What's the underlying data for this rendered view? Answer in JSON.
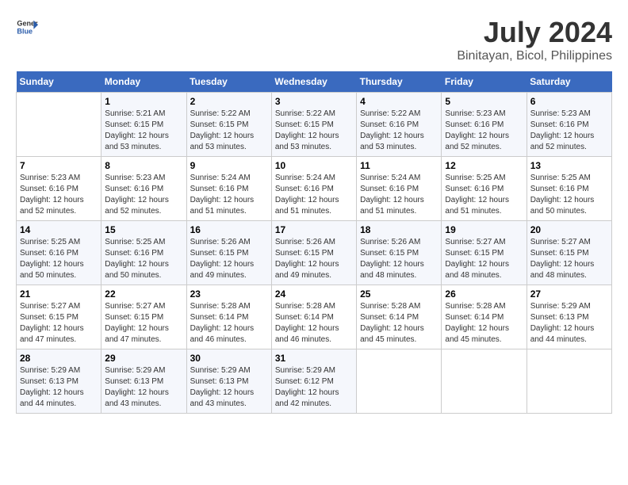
{
  "logo": {
    "line1": "General",
    "line2": "Blue"
  },
  "title": "July 2024",
  "subtitle": "Binitayan, Bicol, Philippines",
  "days_header": [
    "Sunday",
    "Monday",
    "Tuesday",
    "Wednesday",
    "Thursday",
    "Friday",
    "Saturday"
  ],
  "weeks": [
    [
      {
        "num": "",
        "sunrise": "",
        "sunset": "",
        "daylight": ""
      },
      {
        "num": "1",
        "sunrise": "Sunrise: 5:21 AM",
        "sunset": "Sunset: 6:15 PM",
        "daylight": "Daylight: 12 hours and 53 minutes."
      },
      {
        "num": "2",
        "sunrise": "Sunrise: 5:22 AM",
        "sunset": "Sunset: 6:15 PM",
        "daylight": "Daylight: 12 hours and 53 minutes."
      },
      {
        "num": "3",
        "sunrise": "Sunrise: 5:22 AM",
        "sunset": "Sunset: 6:15 PM",
        "daylight": "Daylight: 12 hours and 53 minutes."
      },
      {
        "num": "4",
        "sunrise": "Sunrise: 5:22 AM",
        "sunset": "Sunset: 6:16 PM",
        "daylight": "Daylight: 12 hours and 53 minutes."
      },
      {
        "num": "5",
        "sunrise": "Sunrise: 5:23 AM",
        "sunset": "Sunset: 6:16 PM",
        "daylight": "Daylight: 12 hours and 52 minutes."
      },
      {
        "num": "6",
        "sunrise": "Sunrise: 5:23 AM",
        "sunset": "Sunset: 6:16 PM",
        "daylight": "Daylight: 12 hours and 52 minutes."
      }
    ],
    [
      {
        "num": "7",
        "sunrise": "Sunrise: 5:23 AM",
        "sunset": "Sunset: 6:16 PM",
        "daylight": "Daylight: 12 hours and 52 minutes."
      },
      {
        "num": "8",
        "sunrise": "Sunrise: 5:23 AM",
        "sunset": "Sunset: 6:16 PM",
        "daylight": "Daylight: 12 hours and 52 minutes."
      },
      {
        "num": "9",
        "sunrise": "Sunrise: 5:24 AM",
        "sunset": "Sunset: 6:16 PM",
        "daylight": "Daylight: 12 hours and 51 minutes."
      },
      {
        "num": "10",
        "sunrise": "Sunrise: 5:24 AM",
        "sunset": "Sunset: 6:16 PM",
        "daylight": "Daylight: 12 hours and 51 minutes."
      },
      {
        "num": "11",
        "sunrise": "Sunrise: 5:24 AM",
        "sunset": "Sunset: 6:16 PM",
        "daylight": "Daylight: 12 hours and 51 minutes."
      },
      {
        "num": "12",
        "sunrise": "Sunrise: 5:25 AM",
        "sunset": "Sunset: 6:16 PM",
        "daylight": "Daylight: 12 hours and 51 minutes."
      },
      {
        "num": "13",
        "sunrise": "Sunrise: 5:25 AM",
        "sunset": "Sunset: 6:16 PM",
        "daylight": "Daylight: 12 hours and 50 minutes."
      }
    ],
    [
      {
        "num": "14",
        "sunrise": "Sunrise: 5:25 AM",
        "sunset": "Sunset: 6:16 PM",
        "daylight": "Daylight: 12 hours and 50 minutes."
      },
      {
        "num": "15",
        "sunrise": "Sunrise: 5:25 AM",
        "sunset": "Sunset: 6:16 PM",
        "daylight": "Daylight: 12 hours and 50 minutes."
      },
      {
        "num": "16",
        "sunrise": "Sunrise: 5:26 AM",
        "sunset": "Sunset: 6:15 PM",
        "daylight": "Daylight: 12 hours and 49 minutes."
      },
      {
        "num": "17",
        "sunrise": "Sunrise: 5:26 AM",
        "sunset": "Sunset: 6:15 PM",
        "daylight": "Daylight: 12 hours and 49 minutes."
      },
      {
        "num": "18",
        "sunrise": "Sunrise: 5:26 AM",
        "sunset": "Sunset: 6:15 PM",
        "daylight": "Daylight: 12 hours and 48 minutes."
      },
      {
        "num": "19",
        "sunrise": "Sunrise: 5:27 AM",
        "sunset": "Sunset: 6:15 PM",
        "daylight": "Daylight: 12 hours and 48 minutes."
      },
      {
        "num": "20",
        "sunrise": "Sunrise: 5:27 AM",
        "sunset": "Sunset: 6:15 PM",
        "daylight": "Daylight: 12 hours and 48 minutes."
      }
    ],
    [
      {
        "num": "21",
        "sunrise": "Sunrise: 5:27 AM",
        "sunset": "Sunset: 6:15 PM",
        "daylight": "Daylight: 12 hours and 47 minutes."
      },
      {
        "num": "22",
        "sunrise": "Sunrise: 5:27 AM",
        "sunset": "Sunset: 6:15 PM",
        "daylight": "Daylight: 12 hours and 47 minutes."
      },
      {
        "num": "23",
        "sunrise": "Sunrise: 5:28 AM",
        "sunset": "Sunset: 6:14 PM",
        "daylight": "Daylight: 12 hours and 46 minutes."
      },
      {
        "num": "24",
        "sunrise": "Sunrise: 5:28 AM",
        "sunset": "Sunset: 6:14 PM",
        "daylight": "Daylight: 12 hours and 46 minutes."
      },
      {
        "num": "25",
        "sunrise": "Sunrise: 5:28 AM",
        "sunset": "Sunset: 6:14 PM",
        "daylight": "Daylight: 12 hours and 45 minutes."
      },
      {
        "num": "26",
        "sunrise": "Sunrise: 5:28 AM",
        "sunset": "Sunset: 6:14 PM",
        "daylight": "Daylight: 12 hours and 45 minutes."
      },
      {
        "num": "27",
        "sunrise": "Sunrise: 5:29 AM",
        "sunset": "Sunset: 6:13 PM",
        "daylight": "Daylight: 12 hours and 44 minutes."
      }
    ],
    [
      {
        "num": "28",
        "sunrise": "Sunrise: 5:29 AM",
        "sunset": "Sunset: 6:13 PM",
        "daylight": "Daylight: 12 hours and 44 minutes."
      },
      {
        "num": "29",
        "sunrise": "Sunrise: 5:29 AM",
        "sunset": "Sunset: 6:13 PM",
        "daylight": "Daylight: 12 hours and 43 minutes."
      },
      {
        "num": "30",
        "sunrise": "Sunrise: 5:29 AM",
        "sunset": "Sunset: 6:13 PM",
        "daylight": "Daylight: 12 hours and 43 minutes."
      },
      {
        "num": "31",
        "sunrise": "Sunrise: 5:29 AM",
        "sunset": "Sunset: 6:12 PM",
        "daylight": "Daylight: 12 hours and 42 minutes."
      },
      {
        "num": "",
        "sunrise": "",
        "sunset": "",
        "daylight": ""
      },
      {
        "num": "",
        "sunrise": "",
        "sunset": "",
        "daylight": ""
      },
      {
        "num": "",
        "sunrise": "",
        "sunset": "",
        "daylight": ""
      }
    ]
  ]
}
